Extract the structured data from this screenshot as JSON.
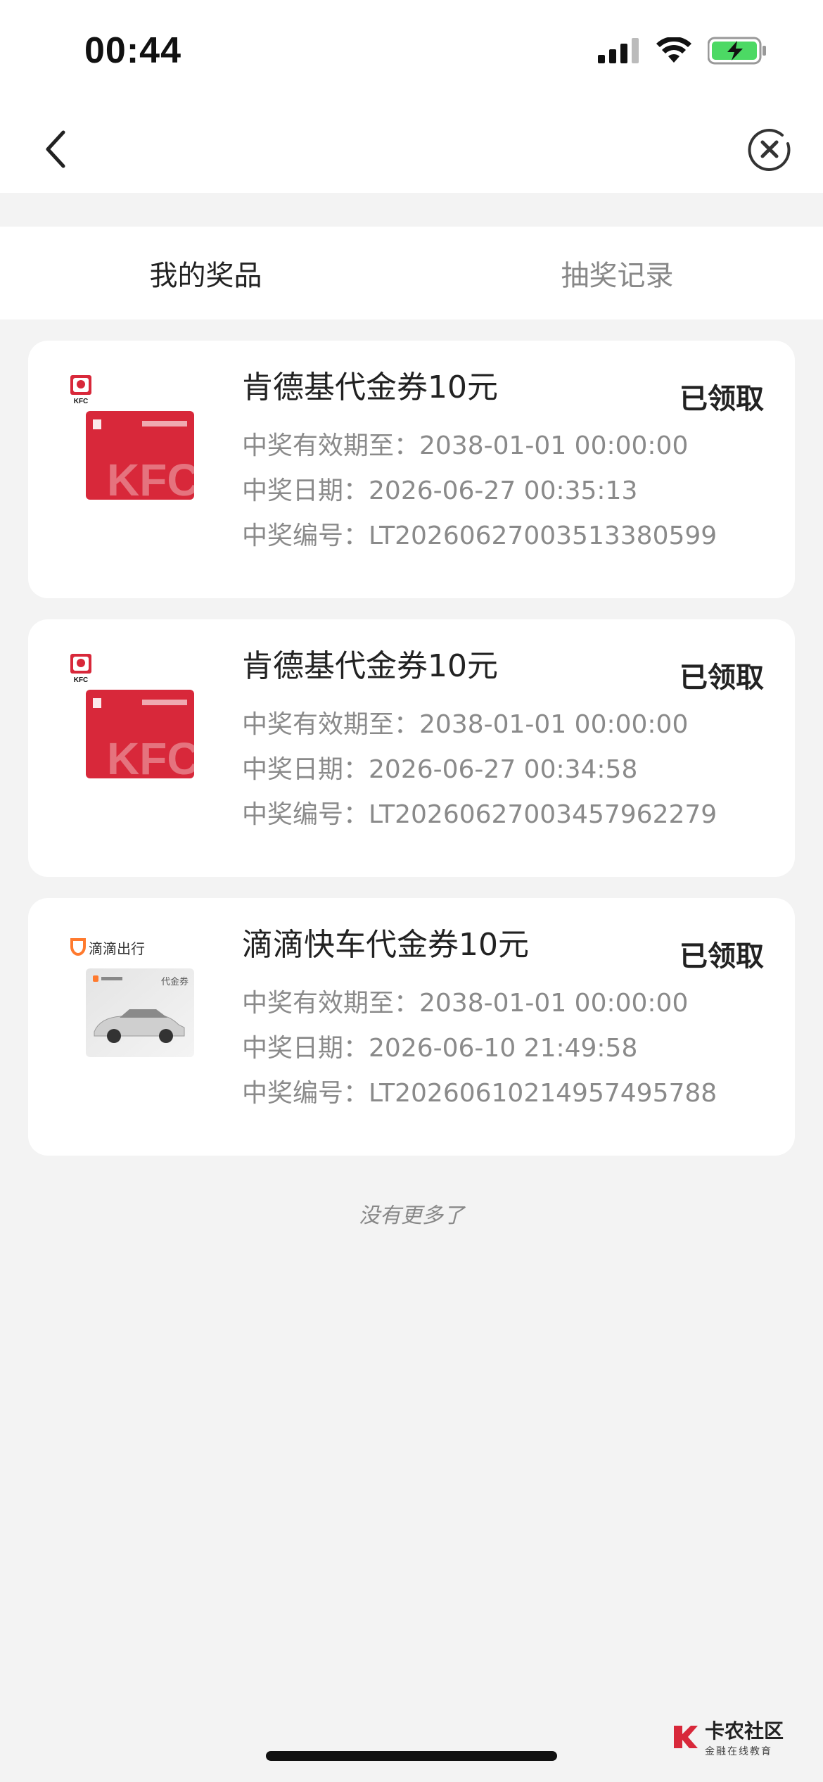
{
  "status_bar": {
    "time": "00:44",
    "icons": [
      "signal-icon",
      "wifi-icon",
      "battery-charging-icon"
    ],
    "battery_color": "#4cd964"
  },
  "nav": {
    "back_icon": "chevron-left-icon",
    "close_icon": "close-circle-icon"
  },
  "tabs": [
    {
      "label": "我的奖品",
      "active": true
    },
    {
      "label": "抽奖记录",
      "active": false
    }
  ],
  "prizes": [
    {
      "brand": "KFC",
      "coupon_type": "kfc",
      "title": "肯德基代金券10元",
      "status": "已领取",
      "valid_label": "中奖有效期至：",
      "valid_value": "2038-01-01 00:00:00",
      "date_label": "中奖日期：",
      "date_value": "2026-06-27 00:35:13",
      "code_label": "中奖编号：",
      "code_value": "LT20260627003513380599"
    },
    {
      "brand": "KFC",
      "coupon_type": "kfc",
      "title": "肯德基代金券10元",
      "status": "已领取",
      "valid_label": "中奖有效期至：",
      "valid_value": "2038-01-01 00:00:00",
      "date_label": "中奖日期：",
      "date_value": "2026-06-27 00:34:58",
      "code_label": "中奖编号：",
      "code_value": "LT20260627003457962279"
    },
    {
      "brand": "滴滴出行",
      "coupon_type": "didi",
      "coupon_label": "代金券",
      "title": "滴滴快车代金券10元",
      "status": "已领取",
      "valid_label": "中奖有效期至：",
      "valid_value": "2038-01-01 00:00:00",
      "date_label": "中奖日期：",
      "date_value": "2026-06-10 21:49:58",
      "code_label": "中奖编号：",
      "code_value": "LT20260610214957495788"
    }
  ],
  "footer": {
    "no_more": "没有更多了"
  },
  "watermark": {
    "title": "卡农社区",
    "subtitle": "金融在线教育"
  },
  "colors": {
    "kfc_red": "#d8283a",
    "didi_orange": "#ff7a2e",
    "background": "#f3f3f3"
  }
}
